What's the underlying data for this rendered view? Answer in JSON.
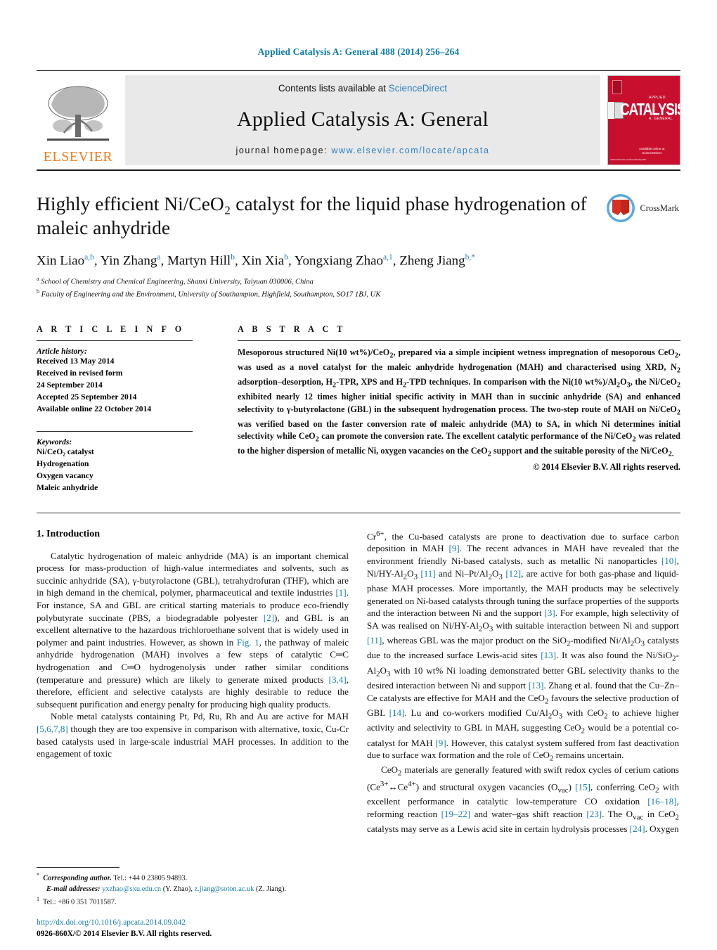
{
  "running_head": "Applied Catalysis A: General 488 (2014) 256–264",
  "masthead": {
    "contents_prefix": "Contents lists available at",
    "sciencedirect": "ScienceDirect",
    "journal_title": "Applied Catalysis A: General",
    "homepage_prefix": "journal homepage:",
    "homepage_url": "www.elsevier.com/locate/apcata",
    "publisher": "ELSEVIER",
    "cover_word": "CATALYSIS",
    "cover_small_top": "APPLIED",
    "cover_small_bottom": "A: GENERAL",
    "cover_footer": "Available online at\nScienceDirect"
  },
  "article": {
    "title": "Highly efficient Ni/CeO₂ catalyst for the liquid phase hydrogenation of maleic anhydride",
    "crossmark_label": "CrossMark",
    "authors_html": "Xin Liao<sup>a,b</sup>, Yin Zhang<sup>a</sup>, Martyn Hill<sup>b</sup>, Xin Xia<sup>b</sup>, Yongxiang Zhao<sup>a,1</sup>, Zheng Jiang<sup>b,*</sup>",
    "affiliations": [
      {
        "marker": "a",
        "text": "School of Chemistry and Chemical Engineering, Shanxi University, Taiyuan 030006, China"
      },
      {
        "marker": "b",
        "text": "Faculty of Engineering and the Environment, University of Southampton, Highfield, Southampton, SO17 1BJ, UK"
      }
    ]
  },
  "article_info": {
    "heading": "A R T I C L E   I N F O",
    "history_label": "Article history:",
    "history_lines": [
      "Received 13 May 2014",
      "Received in revised form",
      "24 September 2014",
      "Accepted 25 September 2014",
      "Available online 22 October 2014"
    ],
    "keywords_label": "Keywords:",
    "keywords": [
      "Ni/CeO₂ catalyst",
      "Hydrogenation",
      "Oxygen vacancy",
      "Maleic anhydride"
    ]
  },
  "abstract": {
    "heading": "A B S T R A C T",
    "text_html": "Mesoporous structured Ni(10 wt%)/CeO<sub>2</sub>, prepared via a simple incipient wetness impregnation of mesoporous CeO<sub>2</sub>, was used as a novel catalyst for the maleic anhydride hydrogenation (MAH) and characterised using XRD, N<sub>2</sub> adsorption–desorption, H<sub>2</sub>-TPR, XPS and H<sub>2</sub>-TPD techniques. In comparison with the Ni(10 wt%)/Al<sub>2</sub>O<sub>3</sub>, the Ni/CeO<sub>2</sub> exhibited nearly 12 times higher initial specific activity in MAH than in succinic anhydride (SA) and enhanced selectivity to γ-butyrolactone (GBL) in the subsequent hydrogenation process. The two-step route of MAH on Ni/CeO<sub>2</sub> was verified based on the faster conversion rate of maleic anhydride (MA) to SA, in which Ni determines initial selectivity while CeO<sub>2</sub> can promote the conversion rate. The excellent catalytic performance of the Ni/CeO<sub>2</sub> was related to the higher dispersion of metallic Ni, oxygen vacancies on the CeO<sub>2</sub> support and the suitable porosity of the Ni/CeO<sub>2</>.",
    "copyright": "© 2014 Elsevier B.V. All rights reserved."
  },
  "introduction": {
    "heading": "1.  Introduction",
    "left_paragraphs_html": [
      "Catalytic hydrogenation of maleic anhydride (MA) is an important chemical process for mass-production of high-value intermediates and solvents, such as succinic anhydride (SA), γ-butyrolactone (GBL), tetrahydrofuran (THF), which are in high demand in the chemical, polymer, pharmaceutical and textile industries <span class=\"ref\">[1]</span>. For instance, SA and GBL are critical starting materials to produce eco-friendly polybutyrate succinate (PBS, a biodegradable polyester <span class=\"ref\">[2]</span>), and GBL is an excellent alternative to the hazardous trichloroethane solvent that is widely used in polymer and paint industries. However, as shown in <span class=\"ref\">Fig. 1</span>, the pathway of maleic anhydride hydrogenation (MAH) involves a few steps of catalytic C═C hydrogenation and C═O hydrogenolysis under rather similar conditions (temperature and pressure) which are likely to generate mixed products <span class=\"ref\">[3,4]</span>, therefore, efficient and selective catalysts are highly desirable to reduce the subsequent purification and energy penalty for producing high quality products.",
      "Noble metal catalysts containing Pt, Pd, Ru, Rh and Au are active for MAH <span class=\"ref\">[5,6,7,8]</span> though they are too expensive in comparison with alternative, toxic, Cu-Cr based catalysts used in large-scale industrial MAH processes. In addition to the engagement of toxic"
    ],
    "right_paragraphs_html": [
      "Cr<sup>6+</sup>, the Cu-based catalysts are prone to deactivation due to surface carbon deposition in MAH <span class=\"ref\">[9]</span>. The recent advances in MAH have revealed that the environment friendly Ni-based catalysts, such as metallic Ni nanoparticles <span class=\"ref\">[10]</span>, Ni/HY-Al<sub>2</sub>O<sub>3</sub> <span class=\"ref\">[11]</span> and Ni–Pt/Al<sub>2</sub>O<sub>3</sub> <span class=\"ref\">[12]</span>, are active for both gas-phase and liquid-phase MAH processes. More importantly, the MAH products may be selectively generated on Ni-based catalysts through tuning the surface properties of the supports and the interaction between Ni and the support <span class=\"ref\">[3]</span>. For example, high selectivity of SA was realised on Ni/HY-Al<sub>2</sub>O<sub>3</sub> with suitable interaction between Ni and support <span class=\"ref\">[11]</span>, whereas GBL was the major product on the SiO<sub>2</sub>-modified Ni/Al<sub>2</sub>O<sub>3</sub> catalysts due to the increased surface Lewis-acid sites <span class=\"ref\">[13]</span>. It was also found the Ni/SiO<sub>2</sub>-Al<sub>2</sub>O<sub>3</sub> with 10 wt% Ni loading demonstrated better GBL selectivity thanks to the desired interaction between Ni and support <span class=\"ref\">[13]</span>. Zhang et al. found that the Cu–Zn–Ce catalysts are effective for MAH and the CeO<sub>2</sub> favours the selective production of GBL <span class=\"ref\">[14]</span>. Lu and co-workers modified Cu/Al<sub>2</sub>O<sub>3</sub> with CeO<sub>2</sub> to achieve higher activity and selectivity to GBL in MAH, suggesting CeO<sub>2</sub> would be a potential co-catalyst for MAH <span class=\"ref\">[9]</span>. However, this catalyst system suffered from fast deactivation due to surface wax formation and the role of CeO<sub>2</sub> remains uncertain.",
      "CeO<sub>2</sub> materials are generally featured with swift redox cycles of cerium cations (Ce<sup>3+</sup>↔Ce<sup>4+</sup>) and structural oxygen vacancies (O<sub>vac</sub>) <span class=\"ref\">[15]</span>, conferring CeO<sub>2</sub> with excellent performance in catalytic low-temperature CO oxidation <span class=\"ref\">[16–18]</span>, reforming reaction <span class=\"ref\">[19–22]</span> and water–gas shift reaction <span class=\"ref\">[23]</span>. The O<sub>vac</sub> in CeO<sub>2</sub> catalysts may serve as a Lewis acid site in certain hydrolysis processes <span class=\"ref\">[24]</span>. Oxygen"
    ]
  },
  "footnotes": {
    "corresponding_html": "<sup>*</sup>&nbsp; <i>Corresponding author.</i> Tel.: +44 0 23805 94893.",
    "email_html": "<i>E-mail addresses:</i> <span class=\"lnk\">yxzhao@sxu.edu.cn</span> (Y. Zhao), <span class=\"lnk\">z.jiang@soton.ac.uk</span> (Z. Jiang).",
    "tel_html": "<sup>1</sup>&nbsp; Tel.: +86 0 351 7011587."
  },
  "footer": {
    "doi": "http://dx.doi.org/10.1016/j.apcata.2014.09.042",
    "issn_line": "0926-860X/© 2014 Elsevier B.V. All rights reserved."
  },
  "colors": {
    "link_blue": "#1a7fa8",
    "sciencedirect_blue": "#2b7fbf",
    "elsevier_orange": "#f07c1c",
    "cover_red": "#c8102e"
  }
}
